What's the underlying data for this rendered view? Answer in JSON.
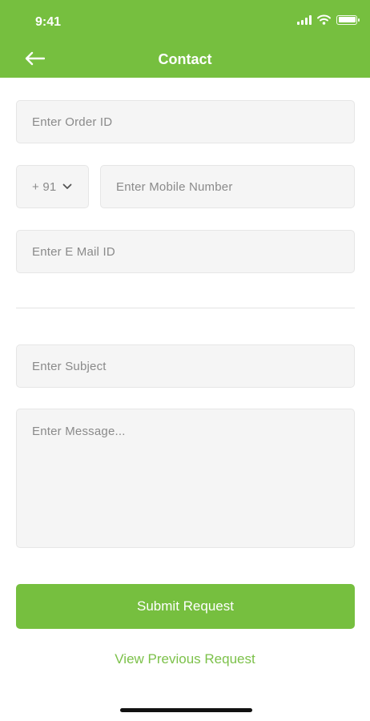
{
  "status_bar": {
    "time": "9:41"
  },
  "header": {
    "title": "Contact"
  },
  "form": {
    "order_id_placeholder": "Enter Order ID",
    "country_code": "+ 91",
    "mobile_placeholder": "Enter Mobile Number",
    "email_placeholder": "Enter E Mail ID",
    "subject_placeholder": "Enter Subject",
    "message_placeholder": "Enter Message..."
  },
  "actions": {
    "submit_label": "Submit Request",
    "view_previous_label": "View Previous Request"
  },
  "colors": {
    "brand_green": "#76bf3f",
    "field_bg": "#f5f5f5",
    "placeholder_text": "#8a8a8a",
    "link_green": "#7cc14a"
  }
}
